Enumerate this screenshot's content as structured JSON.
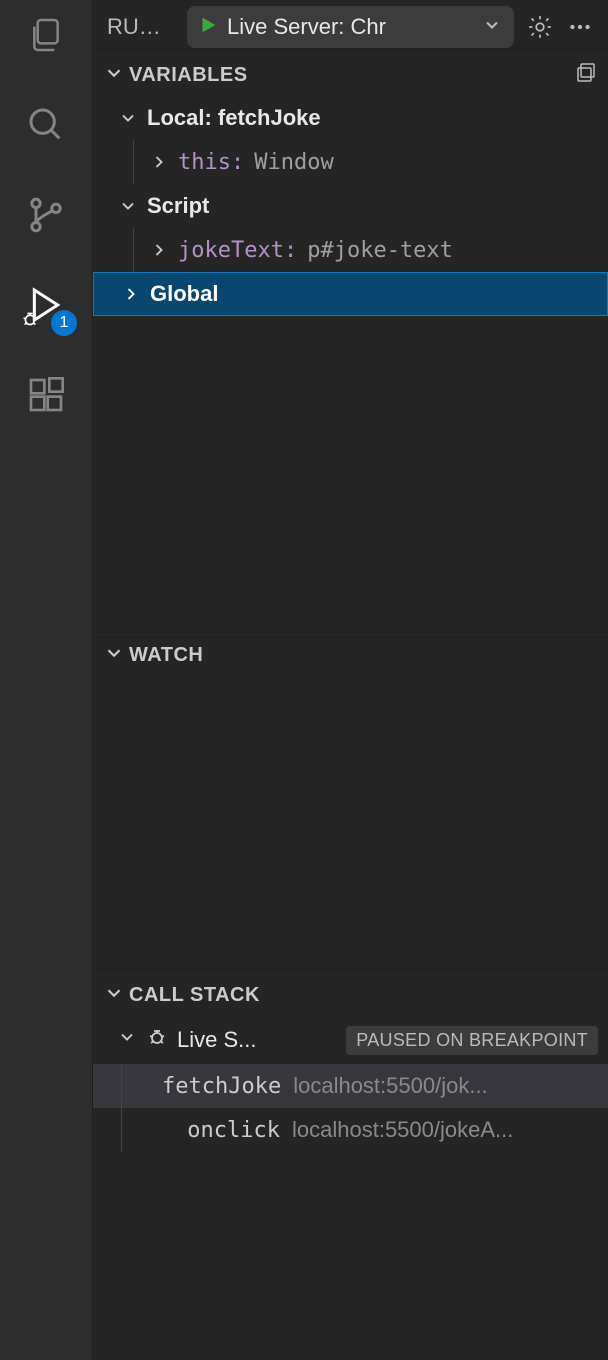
{
  "activity_bar": {
    "badge_count": "1"
  },
  "top_bar": {
    "run_label": "RUN ...",
    "config_name": "Live Server: Chr"
  },
  "sections": {
    "variables": {
      "title": "VARIABLES",
      "scopes": [
        {
          "name": "Local: fetchJoke",
          "vars": [
            {
              "name": "this:",
              "value": "Window"
            }
          ]
        },
        {
          "name": "Script",
          "vars": [
            {
              "name": "jokeText:",
              "value": "p#joke-text"
            }
          ]
        }
      ],
      "global": "Global"
    },
    "watch": {
      "title": "WATCH"
    },
    "callstack": {
      "title": "CALL STACK",
      "thread_name": "Live S...",
      "status": "PAUSED ON BREAKPOINT",
      "frames": [
        {
          "name": "fetchJoke",
          "loc": "localhost:5500/jok..."
        },
        {
          "name": "onclick",
          "loc": "localhost:5500/jokeA..."
        }
      ]
    }
  }
}
